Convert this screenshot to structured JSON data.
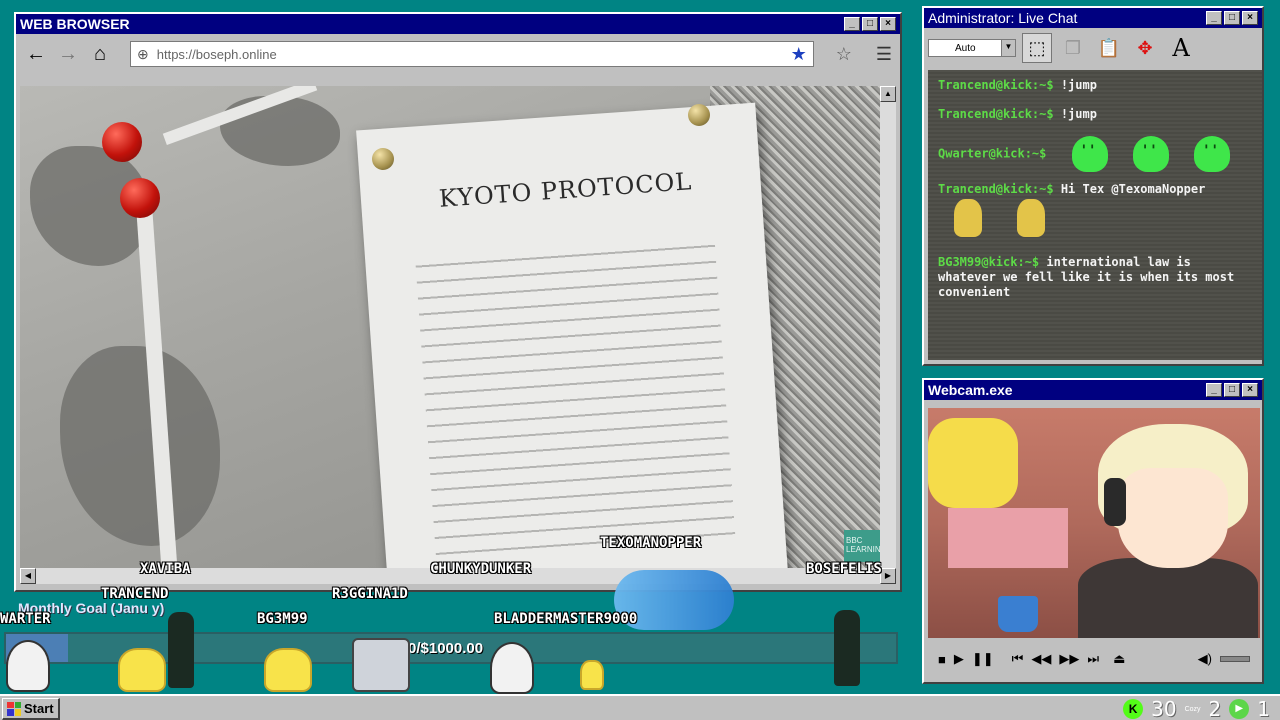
{
  "browser": {
    "title": "WEB BROWSER",
    "url": "https://boseph.online",
    "page_title": "KYOTO PROTOCOL",
    "watermark": "BBC LEARNING"
  },
  "chat_window": {
    "title": "Administrator: Live Chat",
    "font_size_option": "Auto",
    "messages": [
      {
        "user": "Trancend@kick:~$",
        "text": "!jump"
      },
      {
        "user": "Trancend@kick:~$",
        "text": "!jump"
      },
      {
        "user": "Qwarter@kick:~$",
        "text": "",
        "emotes": [
          "slime-emote",
          "slime-emote",
          "slime-emote"
        ]
      },
      {
        "user": "Trancend@kick:~$",
        "text": "Hi Tex @TexomaNopper",
        "emotes": [
          "kid-emote",
          "kid-emote"
        ]
      },
      {
        "user": "BG3M99@kick:~$",
        "text": "international law is whatever we fell like it is when its most convenient"
      }
    ]
  },
  "webcam": {
    "title": "Webcam.exe"
  },
  "overlay": {
    "goal_label": "Monthly Goal (Janu   y)",
    "goal_text": "0/$1000.00",
    "goal_progress_fraction": 0.07,
    "usernames": [
      "XAVIBA",
      "TRANCEND",
      "WARTER",
      "BG3M99",
      "R3GGINA1D",
      "CHUNKYDUNKER",
      "TEXOMANOPPER",
      "BLADDERMASTER9000",
      "BOSEFELIS"
    ]
  },
  "taskbar": {
    "start_label": "Start",
    "tray_values": [
      "30",
      "2",
      "1"
    ],
    "tray_small": "Cozy"
  },
  "colors": {
    "desktop": "#008484",
    "titlebar": "#000080",
    "prompt": "#5ddb47",
    "kick": "#53fc18"
  }
}
